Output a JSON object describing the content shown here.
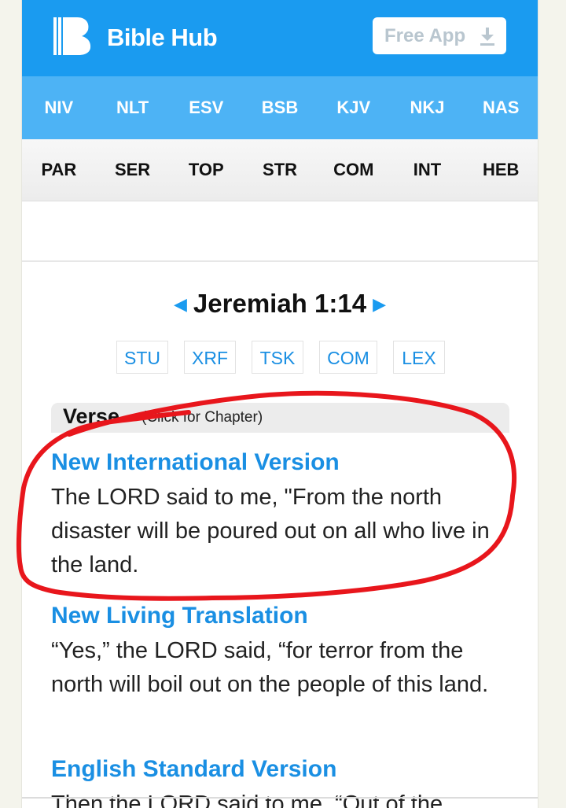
{
  "header": {
    "brand": "Bible Hub",
    "free_app_label": "Free App"
  },
  "nav_primary": [
    "NIV",
    "NLT",
    "ESV",
    "BSB",
    "KJV",
    "NKJ",
    "NAS"
  ],
  "nav_secondary": [
    "PAR",
    "SER",
    "TOP",
    "STR",
    "COM",
    "INT",
    "HEB"
  ],
  "passage": {
    "reference": "Jeremiah 1:14"
  },
  "tools": [
    "STU",
    "XRF",
    "TSK",
    "COM",
    "LEX"
  ],
  "verse_header": {
    "title": "Verse",
    "note": "(Click for Chapter)"
  },
  "versions": [
    {
      "name": "New International Version",
      "text": "The LORD said to me, \"From the north disaster will be poured out on all who live in the land."
    },
    {
      "name": "New Living Translation",
      "text": "“Yes,” the LORD said, “for terror from the north will boil out on the people of this land."
    },
    {
      "name": "English Standard Version",
      "text": "Then the LORD said to me, “Out of the"
    }
  ],
  "colors": {
    "header_blue": "#1a9bf0",
    "nav_blue": "#4db3f5",
    "link_blue": "#1a8fe3",
    "annotation_red": "#e8161c"
  }
}
